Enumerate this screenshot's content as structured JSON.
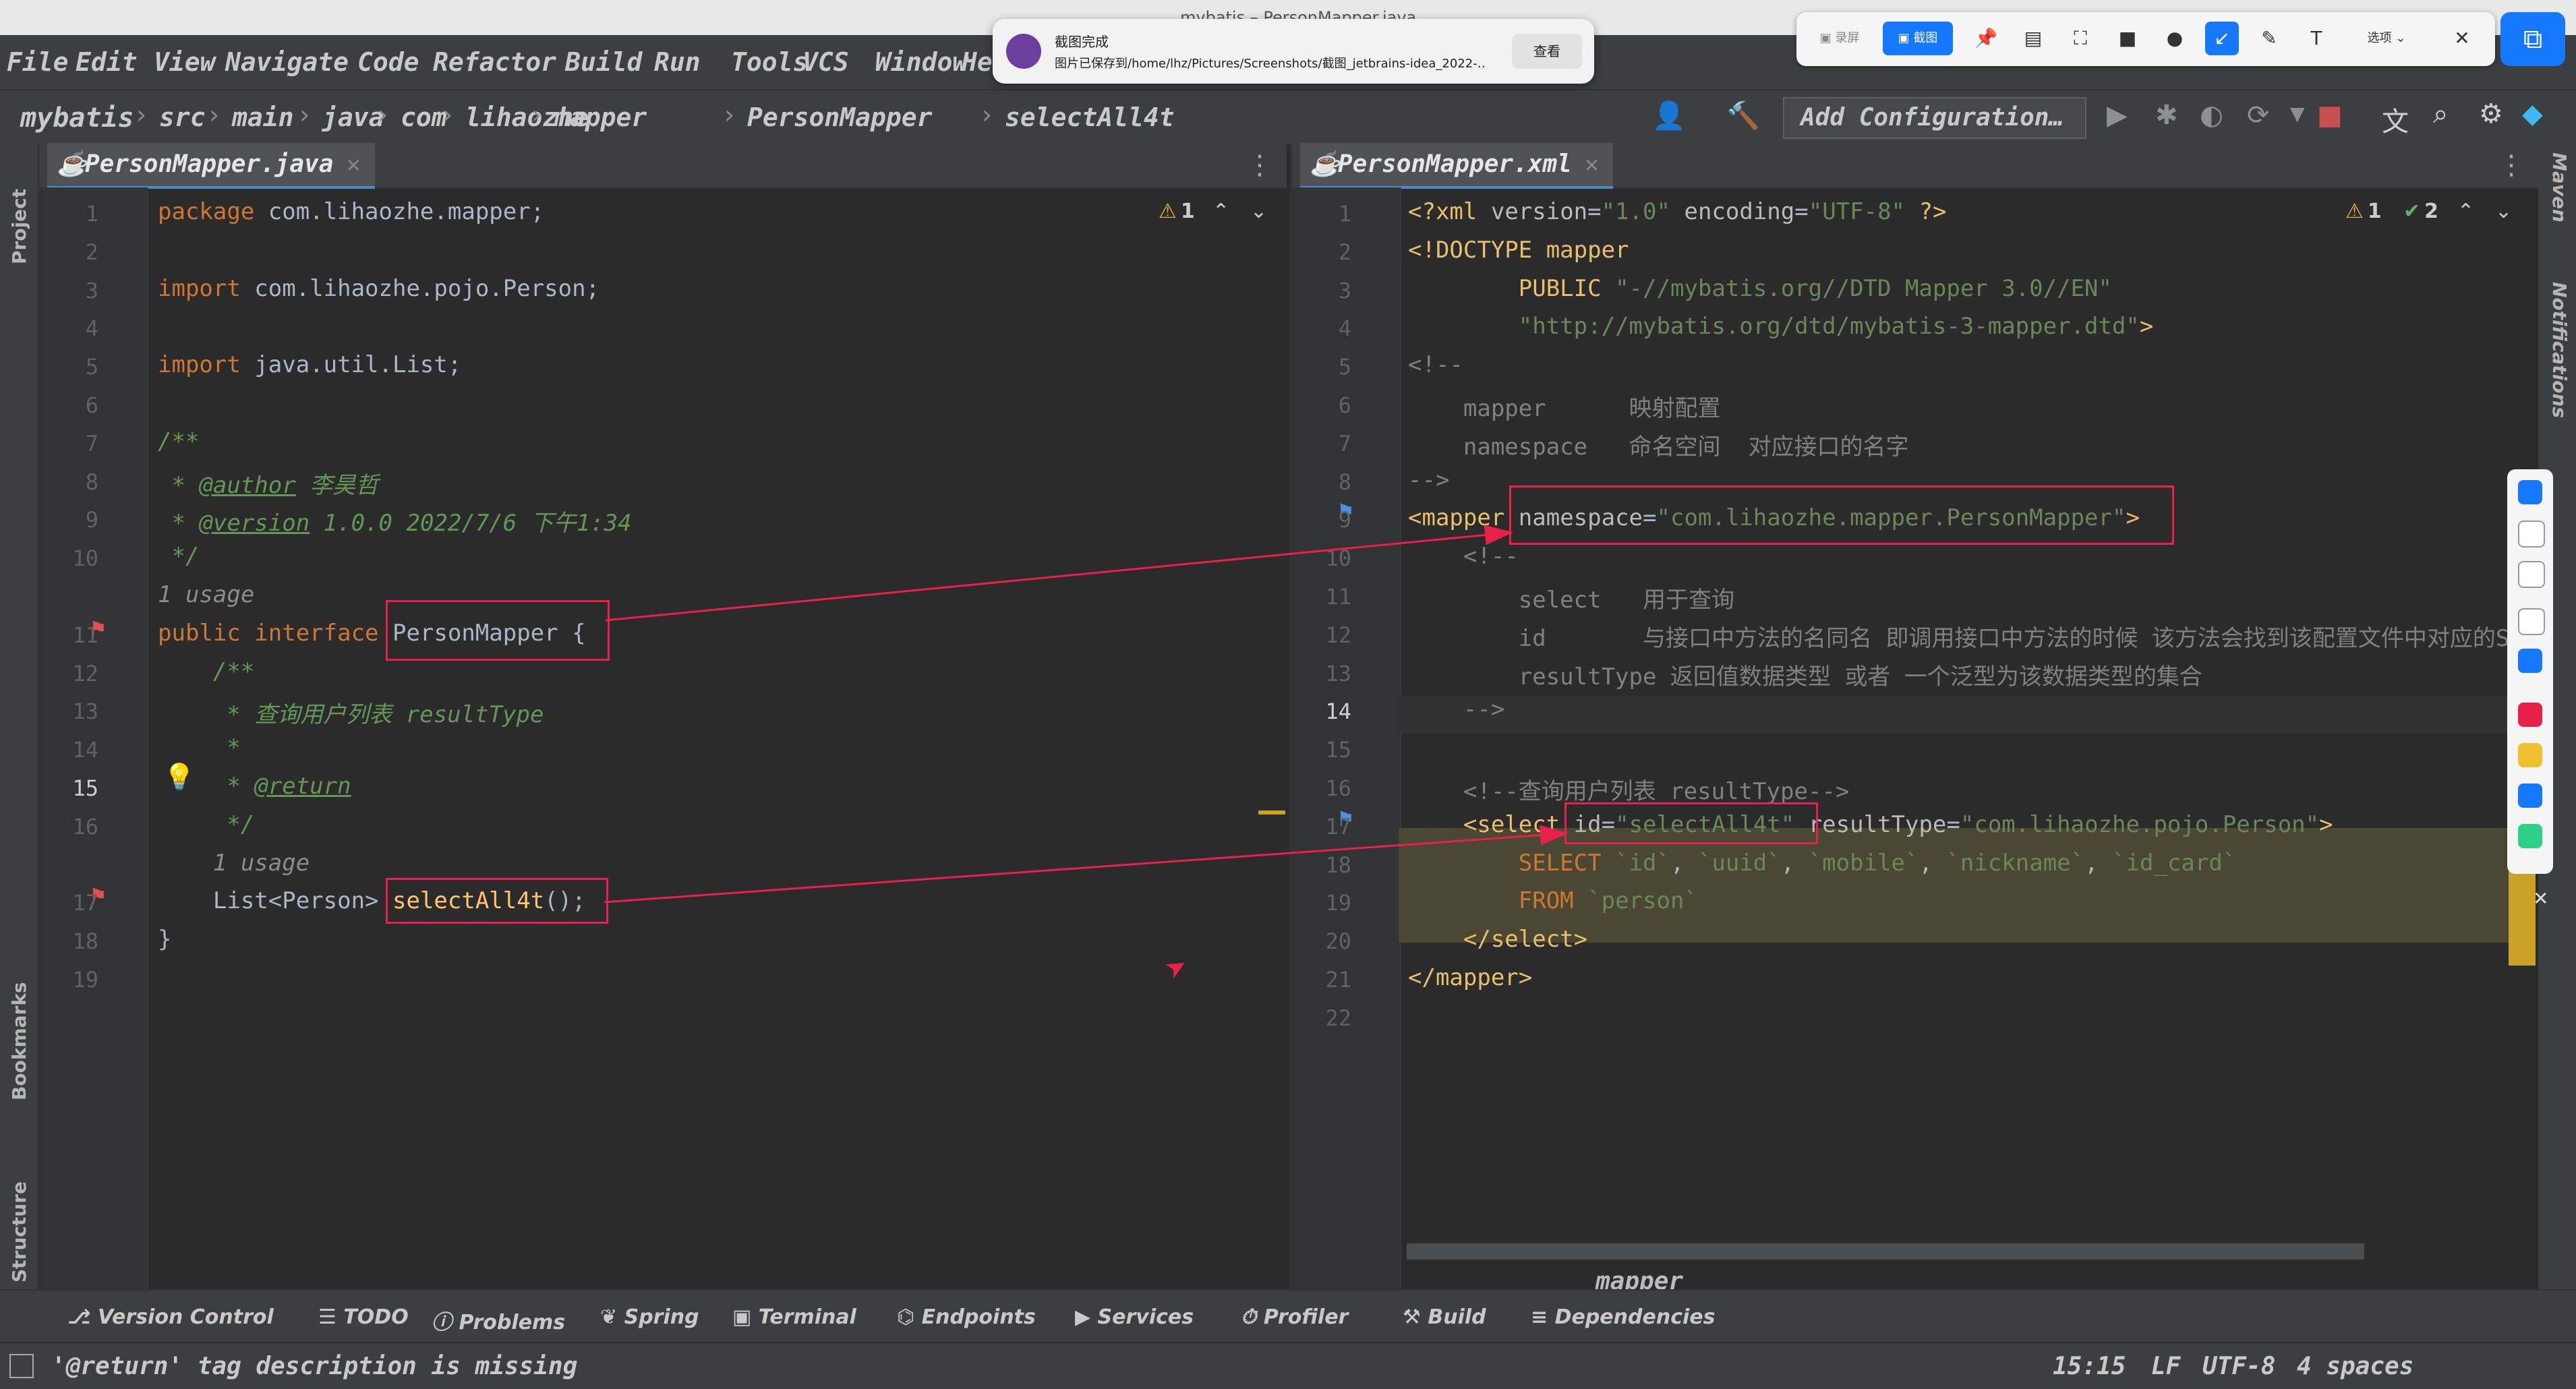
{
  "window": {
    "title": "mybatis – PersonMapper.java"
  },
  "menu": [
    "File",
    "Edit",
    "View",
    "Navigate",
    "Code",
    "Refactor",
    "Build",
    "Run",
    "Tools",
    "VCS",
    "Window",
    "He"
  ],
  "breadcrumb": [
    "mybatis",
    "src",
    "main",
    "java",
    "com",
    "lihaozhe",
    "mapper",
    "PersonMapper",
    "selectAll4t"
  ],
  "toolbar": {
    "config_label": "Add Configuration…"
  },
  "left_editor": {
    "tab": "PersonMapper.java",
    "warnings": "1",
    "lines": [
      {
        "n": "1",
        "html": "<span class='kw'>package</span> com.lihaozhe.mapper;"
      },
      {
        "n": "2",
        "html": ""
      },
      {
        "n": "3",
        "html": "<span class='kw'>import</span> com.lihaozhe.pojo.Person;"
      },
      {
        "n": "4",
        "html": ""
      },
      {
        "n": "5",
        "html": "<span class='kw'>import</span> java.util.List;"
      },
      {
        "n": "6",
        "html": ""
      },
      {
        "n": "7",
        "html": "<span class='cm'>/**</span>"
      },
      {
        "n": "8",
        "html": "<span class='cm'> * </span><span class='annot'>@author</span><span class='cm'> 李昊哲</span>"
      },
      {
        "n": "9",
        "html": "<span class='cm'> * </span><span class='annot'>@version</span><span class='cm'> 1.0.0 2022/7/6 下午1:34</span>"
      },
      {
        "n": "10",
        "html": "<span class='cm'> */</span>"
      },
      {
        "n": "",
        "html": "<span class='hint'>1 usage</span>"
      },
      {
        "n": "11",
        "html": "<span class='kw'>public interface</span> PersonMapper {"
      },
      {
        "n": "12",
        "html": "    <span class='cm'>/**</span>"
      },
      {
        "n": "13",
        "html": "<span class='cm'>     * 查询用户列表 resultType</span>"
      },
      {
        "n": "14",
        "html": "<span class='cm'>     *</span>"
      },
      {
        "n": "15",
        "html": "<span class='cm'>     * </span><span class='annot'>@return</span>"
      },
      {
        "n": "16",
        "html": "<span class='cm'>     */</span>"
      },
      {
        "n": "",
        "html": "    <span class='hint'>1 usage</span>"
      },
      {
        "n": "17",
        "html": "    List&lt;Person&gt; <span style='color:#ffc66d'>selectAll4t</span>();"
      },
      {
        "n": "18",
        "html": "}"
      },
      {
        "n": "19",
        "html": ""
      }
    ]
  },
  "right_editor": {
    "tab": "PersonMapper.xml",
    "warnings": "1",
    "checks": "2",
    "footer": "mapper",
    "lines": [
      {
        "n": "1",
        "html": "<span class='tag'>&lt;?xml</span> <span class='attr'>version</span>=<span class='str'>\"1.0\"</span> <span class='attr'>encoding</span>=<span class='str'>\"UTF-8\"</span> <span class='tag'>?&gt;</span>"
      },
      {
        "n": "2",
        "html": "<span class='tag'>&lt;!DOCTYPE mapper</span>"
      },
      {
        "n": "3",
        "html": "        <span class='tag'>PUBLIC</span> <span class='str'>\"-//mybatis.org//DTD Mapper 3.0//EN\"</span>"
      },
      {
        "n": "4",
        "html": "        <span class='str'>\"http://mybatis.org/dtd/mybatis-3-mapper.dtd\"</span><span class='tag'>&gt;</span>"
      },
      {
        "n": "5",
        "html": "<span class='gray'>&lt;!--</span>"
      },
      {
        "n": "6",
        "html": "<span class='gray'>    mapper      映射配置</span>"
      },
      {
        "n": "7",
        "html": "<span class='gray'>    namespace   命名空间  对应接口的名字</span>"
      },
      {
        "n": "8",
        "html": "<span class='gray'>--&gt;</span>"
      },
      {
        "n": "9",
        "html": "<span class='tag'>&lt;mapper</span> <span class='attr'>namespace</span>=<span class='str'>\"com.lihaozhe.mapper.PersonMapper\"</span><span class='tag'>&gt;</span>"
      },
      {
        "n": "10",
        "html": "    <span class='gray'>&lt;!--</span>"
      },
      {
        "n": "11",
        "html": "<span class='gray'>        select   用于查询</span>"
      },
      {
        "n": "12",
        "html": "<span class='gray'>        id       与接口中方法的名同名 即调用接口中方法的时候 该方法会找到该配置文件中对应的S</span>"
      },
      {
        "n": "13",
        "html": "<span class='gray'>        resultType 返回值数据类型 或者 一个泛型为该数据类型的集合</span>"
      },
      {
        "n": "14",
        "html": "<span class='gray'>    --&gt;</span>"
      },
      {
        "n": "15",
        "html": ""
      },
      {
        "n": "16",
        "html": "    <span class='gray'>&lt;!--查询用户列表 resultType--&gt;</span>"
      },
      {
        "n": "17",
        "html": "    <span class='tag'>&lt;select</span> <span class='attr'>id</span>=<span class='str'>\"selectAll4t\"</span> <span class='attr'>resultType</span>=<span class='str'>\"com.lihaozhe.pojo.Person\"</span><span class='tag'>&gt;</span>"
      },
      {
        "n": "18",
        "html": "        <span class='kw'>SELECT</span> <span class='str'>`id`</span>, <span class='str'>`uuid`</span>, <span class='str'>`mobile`</span>, <span class='str'>`nickname`</span>, <span class='str'>`id_card`</span>"
      },
      {
        "n": "19",
        "html": "        <span class='kw'>FROM</span> <span class='str'>`person`</span>"
      },
      {
        "n": "20",
        "html": "    <span class='tag'>&lt;/select&gt;</span>"
      },
      {
        "n": "21",
        "html": "<span class='tag'>&lt;/mapper&gt;</span>"
      },
      {
        "n": "22",
        "html": ""
      }
    ]
  },
  "bottom_tools": [
    "Version Control",
    "TODO",
    "Problems",
    "Spring",
    "Terminal",
    "Endpoints",
    "Services",
    "Profiler",
    "Build",
    "Dependencies"
  ],
  "status": {
    "message": "'@return' tag description is missing",
    "position": "15:15",
    "line_sep": "LF",
    "encoding": "UTF-8",
    "indent": "4 spaces"
  },
  "notification": {
    "title": "截图完成",
    "body": "图片已保存到/home/lhz/Pictures/Screenshots/截图_jetbrains-idea_2022-…",
    "action": "查看"
  },
  "screenshot_toolbar": {
    "record": "录屏",
    "capture": "截图",
    "options": "选项"
  },
  "side_tabs": {
    "project": "Project",
    "bookmarks": "Bookmarks",
    "structure": "Structure",
    "maven": "Maven",
    "notifications": "Notifications"
  }
}
